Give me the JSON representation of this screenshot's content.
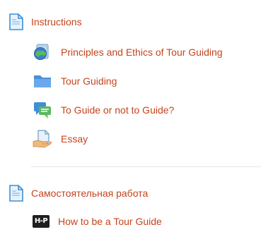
{
  "sections": [
    {
      "title": "Instructions",
      "icon": "page-icon",
      "items": [
        {
          "label": "Principles and Ethics of Tour Guiding",
          "icon": "globe-icon"
        },
        {
          "label": "Tour Guiding",
          "icon": "folder-icon"
        },
        {
          "label": "To Guide or not to Guide?",
          "icon": "forum-icon"
        },
        {
          "label": "Essay",
          "icon": "assignment-icon"
        }
      ]
    },
    {
      "title": "Самостоятельная работа",
      "icon": "page-icon",
      "items": [
        {
          "label": "How to be a Tour Guide",
          "icon": "h5p-icon",
          "icon_text": "H-P"
        }
      ]
    }
  ],
  "colors": {
    "link": "#c4441c",
    "divider": "#e6e6e6"
  }
}
